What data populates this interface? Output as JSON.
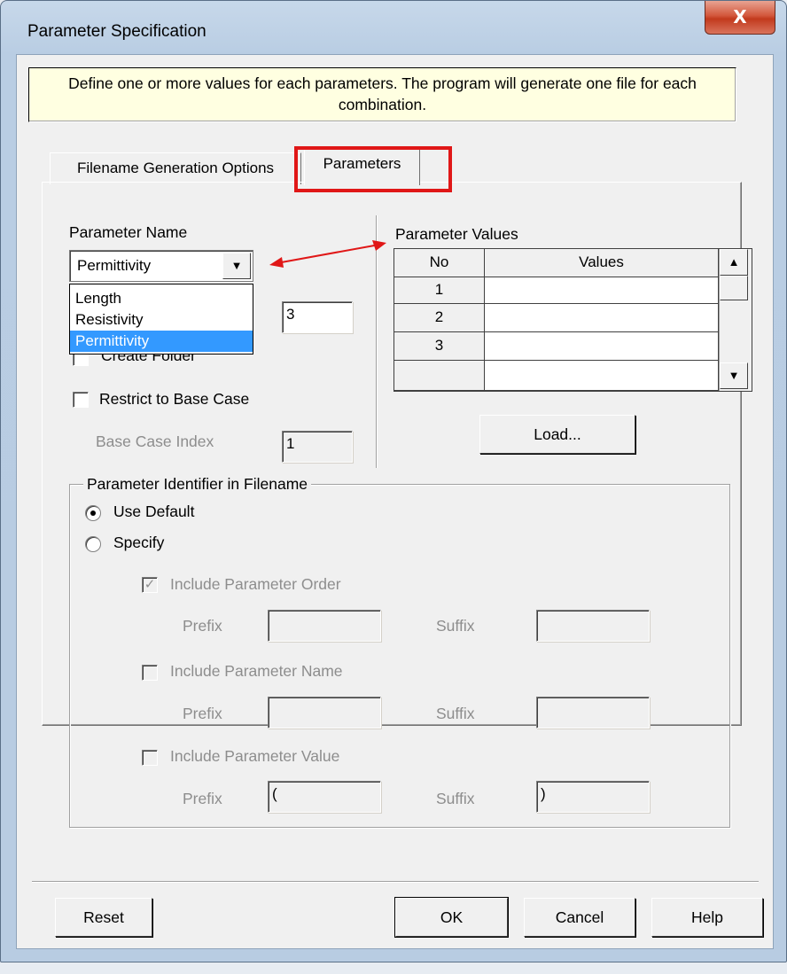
{
  "window": {
    "title": "Parameter Specification",
    "close_glyph": "X"
  },
  "info_text": "Define one or more values for each parameters. The program will generate one file for each combination.",
  "tabs": [
    {
      "label": "Filename Generation Options",
      "selected": false
    },
    {
      "label": "Parameters",
      "selected": true
    }
  ],
  "parameter_name": {
    "label": "Parameter Name",
    "selected": "Permittivity",
    "options": [
      "Length",
      "Resistivity",
      "Permittivity"
    ],
    "highlighted_option": "Permittivity"
  },
  "levels_value": "3",
  "create_folder_label": "Create Folder",
  "restrict_base_case": {
    "label": "Restrict to Base Case",
    "checked": false
  },
  "base_case_index": {
    "label": "Base Case Index",
    "value": "1"
  },
  "parameter_values": {
    "label": "Parameter Values",
    "columns": [
      "No",
      "Values"
    ],
    "rows": [
      {
        "no": "1",
        "value": ""
      },
      {
        "no": "2",
        "value": ""
      },
      {
        "no": "3",
        "value": ""
      }
    ]
  },
  "load_button": "Load...",
  "identifier_group": {
    "title": "Parameter Identifier in Filename",
    "use_default": "Use Default",
    "specify": "Specify",
    "selected": "Use Default",
    "include_order": {
      "label": "Include Parameter Order",
      "checked": true
    },
    "include_name": {
      "label": "Include Parameter Name",
      "checked": false
    },
    "include_value": {
      "label": "Include Parameter Value",
      "checked": false
    },
    "prefix_label": "Prefix",
    "suffix_label": "Suffix",
    "order_prefix": "",
    "order_suffix": "",
    "name_prefix": "",
    "name_suffix": "",
    "value_prefix": "(",
    "value_suffix": ")"
  },
  "buttons": {
    "reset": "Reset",
    "ok": "OK",
    "cancel": "Cancel",
    "help": "Help"
  },
  "annotation_color": "#e01717"
}
